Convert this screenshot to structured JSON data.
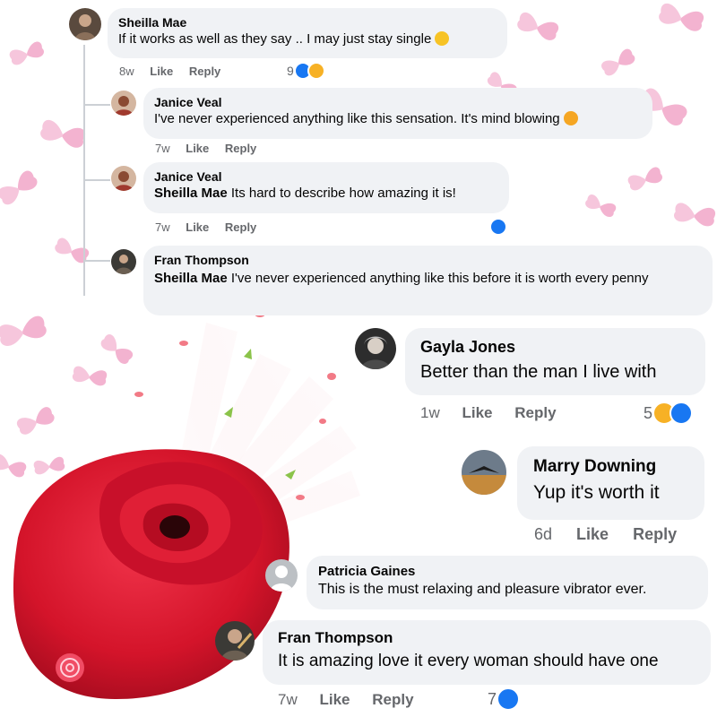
{
  "colors": {
    "bubble": "#f0f2f5",
    "text": "#050505",
    "meta": "#65676b",
    "like_blue": "#1877f2",
    "emoji_yellow": "#f7b125",
    "butterfly_pink": "#f6c6dc",
    "rose_red": "#d4142a"
  },
  "comments": [
    {
      "author": "Sheilla Mae",
      "text": "If it works as well as they say .. I may just stay single",
      "text_emoji": "mouth-covered-emoji",
      "time": "8w",
      "like": "Like",
      "reply": "Reply",
      "reaction_count": "9",
      "reactions": [
        "like-icon",
        "haha-icon"
      ]
    },
    {
      "author": "Janice Veal",
      "text": "I've never experienced anything like this sensation. It's mind blowing",
      "text_emoji": "exploding-head-emoji",
      "time": "7w",
      "like": "Like",
      "reply": "Reply"
    },
    {
      "author": "Janice Veal",
      "tag": "Sheilla Mae",
      "text": "Its hard to describe how amazing it is!",
      "time": "7w",
      "like": "Like",
      "reply": "Reply",
      "reactions": [
        "like-icon"
      ]
    },
    {
      "author": "Fran Thompson",
      "tag": "Sheilla Mae",
      "text": "I've never experienced anything like this before it is worth every penny"
    },
    {
      "author": "Gayla Jones",
      "text": "Better than the man I live with",
      "time": "1w",
      "like": "Like",
      "reply": "Reply",
      "reaction_count": "5",
      "reactions": [
        "haha-icon",
        "like-icon"
      ]
    },
    {
      "author": "Marry Downing",
      "text": "Yup it's worth it",
      "time": "6d",
      "like": "Like",
      "reply": "Reply"
    },
    {
      "author": "Patricia Gaines",
      "text": "This is the must relaxing and pleasure vibrator ever."
    },
    {
      "author": "Fran Thompson",
      "text": "It is amazing love it every woman should have one",
      "time": "7w",
      "like": "Like",
      "reply": "Reply",
      "reaction_count": "7",
      "reactions": [
        "like-icon"
      ]
    }
  ]
}
